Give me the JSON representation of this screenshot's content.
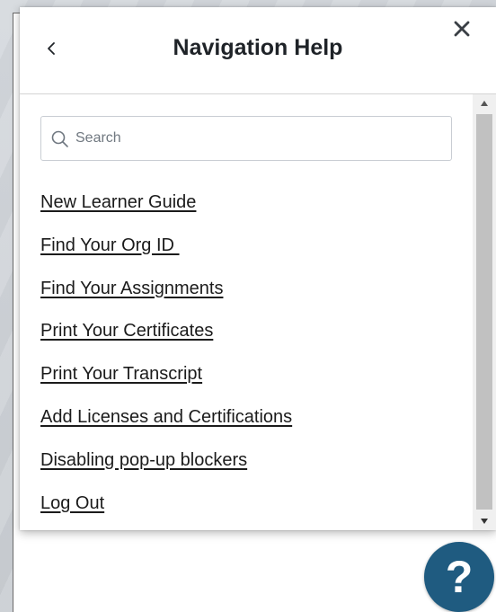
{
  "dialog": {
    "title": "Navigation Help",
    "back_icon": "chevron-left-icon",
    "close_icon": "close-icon"
  },
  "search": {
    "placeholder": "Search",
    "value": "",
    "icon": "search-icon"
  },
  "links": [
    {
      "label": "New Learner Guide"
    },
    {
      "label": "Find Your Org ID "
    },
    {
      "label": "Find Your Assignments"
    },
    {
      "label": "Print Your Certificates"
    },
    {
      "label": "Print Your Transcript"
    },
    {
      "label": "Add Licenses and Certifications"
    },
    {
      "label": "Disabling pop-up blockers"
    },
    {
      "label": "Log Out"
    }
  ],
  "help_button": {
    "symbol": "?",
    "icon": "question-mark-icon"
  },
  "colors": {
    "fab": "#1f5b80",
    "text": "#1b1b1b",
    "title": "#1f2328"
  }
}
